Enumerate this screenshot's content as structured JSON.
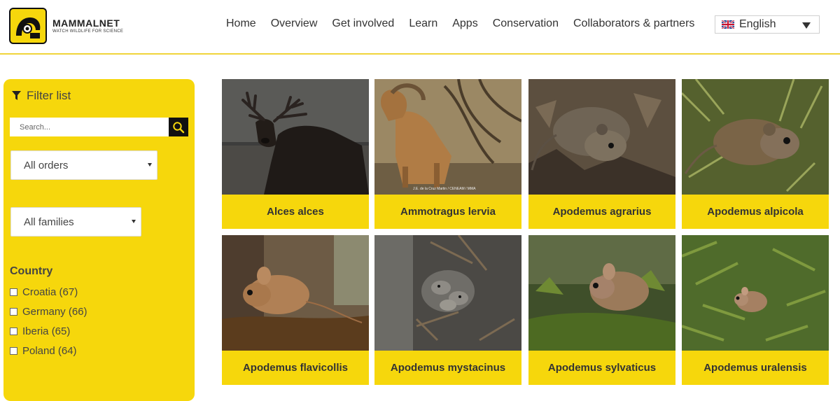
{
  "brand": {
    "name": "MAMMALNET",
    "tagline": "WATCH WILDLIFE FOR SCIENCE",
    "colors": {
      "accent": "#f6d70c",
      "dark": "#111111"
    }
  },
  "nav": {
    "items": [
      "Home",
      "Overview",
      "Get involved",
      "Learn",
      "Apps",
      "Conservation",
      "Collaborators & partners"
    ]
  },
  "language": {
    "selected": "English",
    "flag_icon": "uk-flag-icon"
  },
  "filter": {
    "title": "Filter list",
    "search_placeholder": "Search...",
    "orders_select": "All orders",
    "families_select": "All families",
    "country_heading": "Country",
    "countries": [
      "Croatia (67)",
      "Germany (66)",
      "Iberia (65)",
      "Poland (64)"
    ]
  },
  "species": [
    {
      "name": "Alces alces",
      "photo": "moose-photo"
    },
    {
      "name": "Ammotragus lervia",
      "photo": "barbary-sheep-photo",
      "credit": "J.E. de la Cruz Martin / CENEAM / MMA"
    },
    {
      "name": "Apodemus agrarius",
      "photo": "striped-field-mouse-photo"
    },
    {
      "name": "Apodemus alpicola",
      "photo": "alpine-mouse-photo"
    },
    {
      "name": "Apodemus flavicollis",
      "photo": "yellow-necked-mouse-photo"
    },
    {
      "name": "Apodemus mystacinus",
      "photo": "broad-toothed-mouse-photo"
    },
    {
      "name": "Apodemus sylvaticus",
      "photo": "wood-mouse-photo"
    },
    {
      "name": "Apodemus uralensis",
      "photo": "ural-field-mouse-photo"
    }
  ]
}
